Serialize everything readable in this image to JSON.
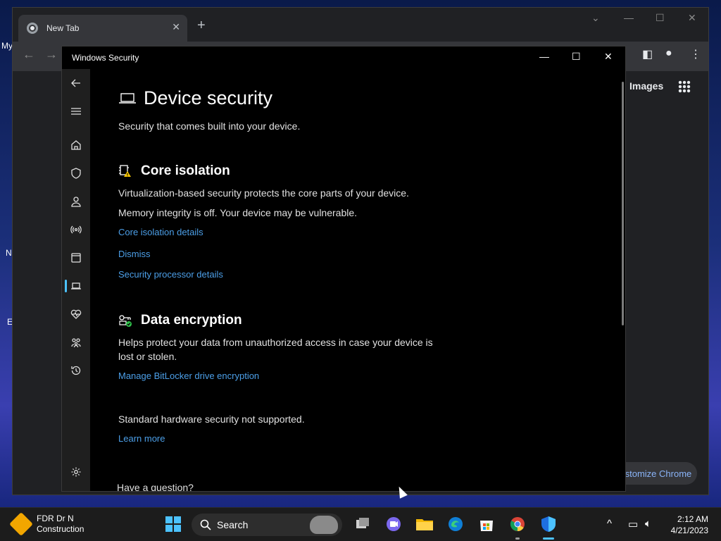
{
  "desktop": {
    "fragments": [
      "My",
      "N",
      "E"
    ]
  },
  "chrome": {
    "tab_title": "New Tab",
    "tab_close": "✕",
    "new_tab": "+",
    "images_link": "Images",
    "customize": "ıstomize Chrome"
  },
  "security": {
    "window_title": "Windows Security",
    "page_title": "Device security",
    "subtitle": "Security that comes built into your device.",
    "core_isolation": {
      "heading": "Core isolation",
      "desc": "Virtualization-based security protects the core parts of your device.",
      "status": "Memory integrity is off. Your device may be vulnerable.",
      "details_link": "Core isolation details",
      "dismiss_link": "Dismiss",
      "processor_link": "Security processor details"
    },
    "data_encryption": {
      "heading": "Data encryption",
      "desc_line1": "Helps protect your data from unauthorized access in case your device is",
      "desc_line2": "lost or stolen.",
      "bitlocker_link": "Manage BitLocker drive encryption"
    },
    "hardware": {
      "status": "Standard hardware security not supported.",
      "learn_more": "Learn more"
    },
    "question": "Have a question?"
  },
  "taskbar": {
    "weather_line1": "FDR Dr N",
    "weather_line2": "Construction",
    "search_label": "Search",
    "time": "2:12 AM",
    "date": "4/21/2023"
  },
  "colors": {
    "accent": "#4cc2ff",
    "link": "#4c9fe8",
    "window_bg": "#000000",
    "nav_bg": "#1f1f1f"
  }
}
